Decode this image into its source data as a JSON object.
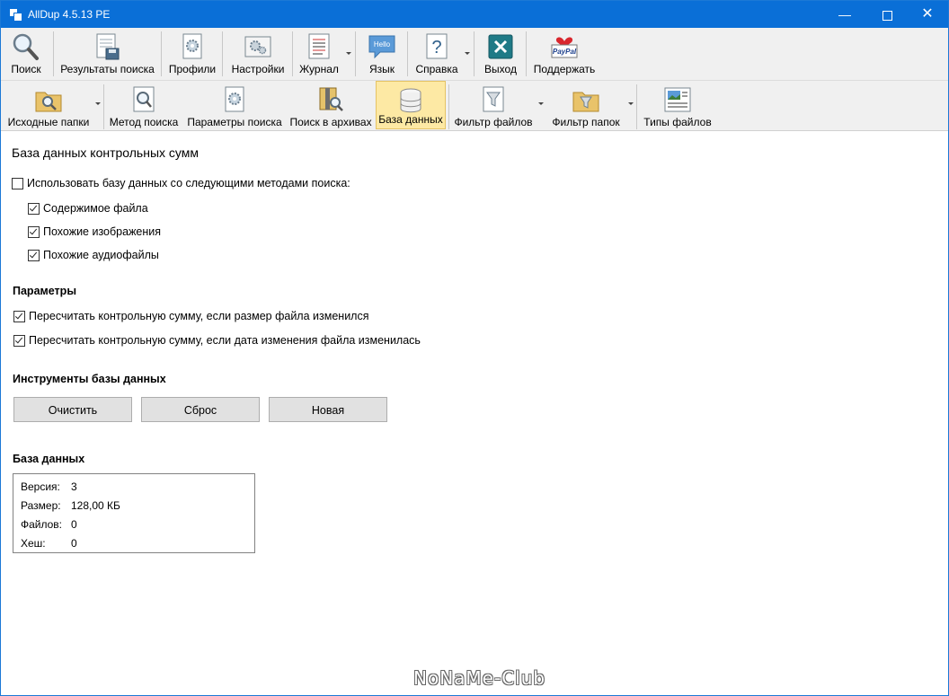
{
  "window": {
    "title": "AllDup 4.5.13 PE"
  },
  "toolbar1": [
    {
      "label": "Поиск",
      "icon": "magnifier-icon"
    },
    {
      "label": "Результаты поиска",
      "icon": "search-results-icon"
    },
    {
      "label": "Профили",
      "icon": "profiles-icon"
    },
    {
      "label": "Настройки",
      "icon": "settings-icon"
    },
    {
      "label": "Журнал",
      "icon": "log-icon"
    },
    {
      "label": "Язык",
      "icon": "hello-language-icon"
    },
    {
      "label": "Справка",
      "icon": "help-icon"
    },
    {
      "label": "Выход",
      "icon": "exit-icon"
    },
    {
      "label": "Поддержать",
      "icon": "paypal-heart-icon"
    }
  ],
  "toolbar2": [
    {
      "label": "Исходные папки",
      "icon": "source-folders-icon"
    },
    {
      "label": "Метод поиска",
      "icon": "search-method-icon"
    },
    {
      "label": "Параметры поиска",
      "icon": "search-params-icon"
    },
    {
      "label": "Поиск в архивах",
      "icon": "archive-search-icon"
    },
    {
      "label": "База данных",
      "icon": "database-icon"
    },
    {
      "label": "Фильтр файлов",
      "icon": "file-filter-icon"
    },
    {
      "label": "Фильтр папок",
      "icon": "folder-filter-icon"
    },
    {
      "label": "Типы файлов",
      "icon": "file-types-icon"
    }
  ],
  "page": {
    "heading": "База данных контрольных сумм",
    "use_db_label": "Использовать базу данных со следующими методами поиска:",
    "use_db_checked": false,
    "methods": [
      {
        "label": "Содержимое файла",
        "checked": true
      },
      {
        "label": "Похожие изображения",
        "checked": true
      },
      {
        "label": "Похожие аудиофайлы",
        "checked": true
      }
    ],
    "params_heading": "Параметры",
    "params": [
      {
        "label": "Пересчитать контрольную сумму, если размер файла изменился",
        "checked": true
      },
      {
        "label": "Пересчитать контрольную сумму, если дата изменения файла изменилась",
        "checked": true
      }
    ],
    "tools_heading": "Инструменты базы данных",
    "buttons": {
      "clear": "Очистить",
      "reset": "Сброс",
      "new": "Новая"
    },
    "db_heading": "База данных",
    "db_info": [
      {
        "key": "Версия:",
        "value": "3"
      },
      {
        "key": "Размер:",
        "value": "128,00 КБ"
      },
      {
        "key": "Файлов:",
        "value": "0"
      },
      {
        "key": "Хеш:",
        "value": "0"
      }
    ]
  },
  "watermark": "NoNaMe-Club"
}
